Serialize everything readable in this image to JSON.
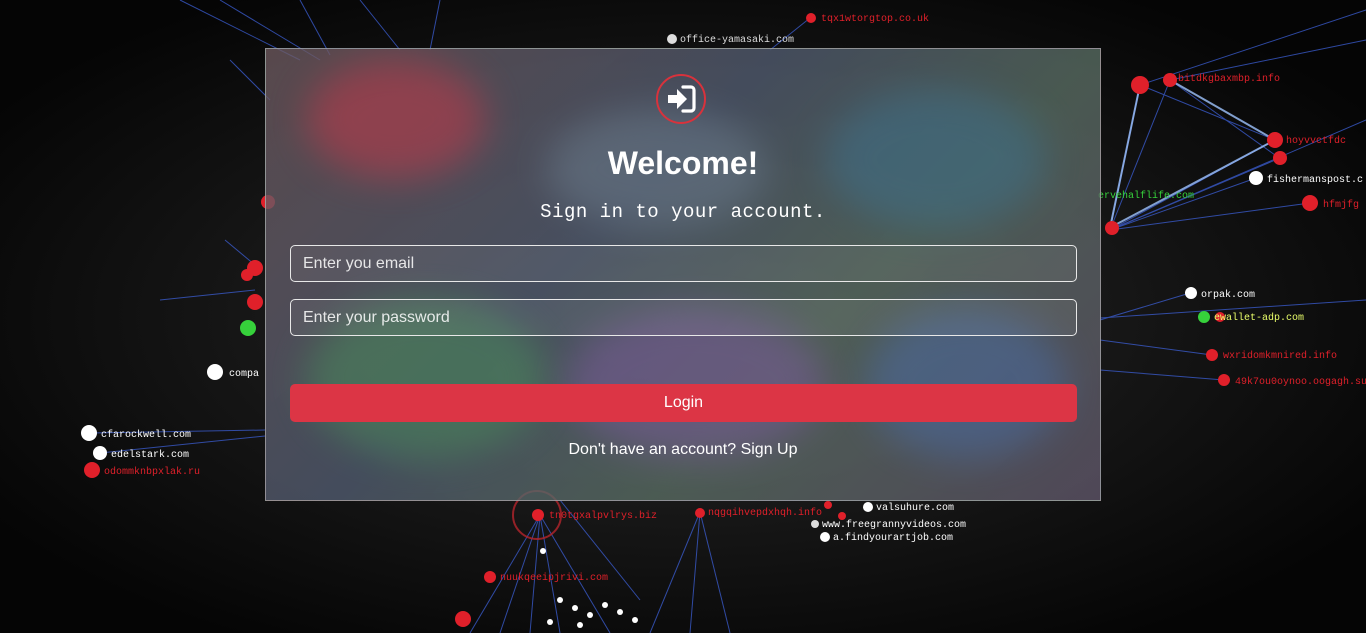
{
  "background": {
    "nodes": [
      {
        "label": "tqx1wtorgtop.co.uk",
        "color": "#e0202a"
      },
      {
        "label": "office-yamasaki.com",
        "color": "#dddddd"
      },
      {
        "label": "bitdkgbaxmbp.info",
        "color": "#e0202a"
      },
      {
        "label": "hoyvvctfdc",
        "color": "#e0202a"
      },
      {
        "label": "fishermanspost.c",
        "color": "#ffffff"
      },
      {
        "label": "hfmjfg",
        "color": "#e0202a"
      },
      {
        "label": "ervehalflife.com",
        "color": "#36d13b"
      },
      {
        "label": "orpak.com",
        "color": "#ffffff"
      },
      {
        "label": "ewallet-adp.com",
        "color": "#36d13b"
      },
      {
        "label": "wxridomkmnired.info",
        "color": "#e0202a"
      },
      {
        "label": "49k7ou0oynoo.oogagh.su",
        "color": "#e0202a"
      },
      {
        "label": "compa",
        "color": "#ffffff"
      },
      {
        "label": "cfarockwell.com",
        "color": "#ffffff"
      },
      {
        "label": "edelstark.com",
        "color": "#ffffff"
      },
      {
        "label": "odommknbpxlak.ru",
        "color": "#e0202a"
      },
      {
        "label": "tn0tgxalpvlrys.biz",
        "color": "#e0202a"
      },
      {
        "label": "nqgqihvepdxhqh.info",
        "color": "#e0202a"
      },
      {
        "label": "valsuhure.com",
        "color": "#ffffff"
      },
      {
        "label": "www.freegrannyvideos.com",
        "color": "#ffffff"
      },
      {
        "label": "a.findyourartjob.com",
        "color": "#ffffff"
      },
      {
        "label": "nuukqeeipjrivi.com",
        "color": "#e0202a"
      }
    ]
  },
  "login": {
    "icon": "sign-in-icon",
    "accent": "#dc3545",
    "title": "Welcome!",
    "subtitle": "Sign in to your account.",
    "email_placeholder": "Enter you email",
    "password_placeholder": "Enter your password",
    "login_label": "Login",
    "signup_text": "Don't have an account? Sign Up"
  }
}
